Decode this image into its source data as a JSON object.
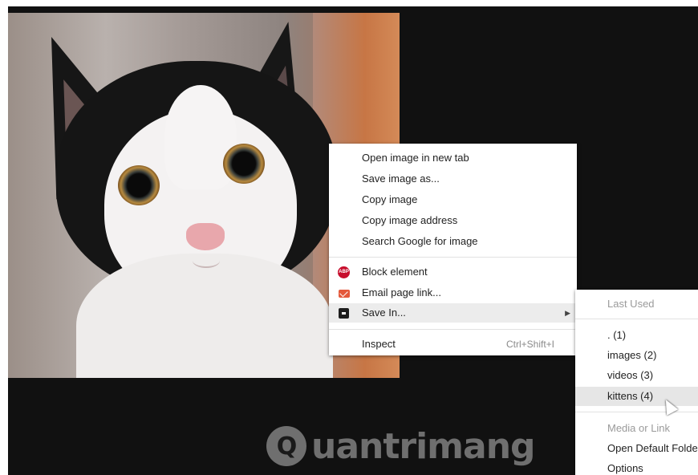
{
  "context_menu": {
    "items": [
      {
        "label": "Open image in new tab"
      },
      {
        "label": "Save image as..."
      },
      {
        "label": "Copy image"
      },
      {
        "label": "Copy image address"
      },
      {
        "label": "Search Google for image"
      },
      {
        "label": "Block element",
        "icon": "adblock-plus-icon"
      },
      {
        "label": "Email page link...",
        "icon": "email-icon"
      },
      {
        "label": "Save In...",
        "icon": "save-in-icon",
        "has_submenu": true
      },
      {
        "label": "Inspect",
        "shortcut": "Ctrl+Shift+I"
      }
    ],
    "abp_icon_text": "ABP"
  },
  "submenu": {
    "last_used_header": "Last Used",
    "folders": [
      {
        "label": ". (1)"
      },
      {
        "label": "images (2)"
      },
      {
        "label": "videos (3)"
      },
      {
        "label": "kittens (4)"
      }
    ],
    "media_header": "Media or Link",
    "actions": [
      {
        "label": "Open Default Folder"
      },
      {
        "label": "Options"
      }
    ]
  },
  "watermark": {
    "text": "uantrimang",
    "badge": "Q"
  },
  "colors": {
    "background": "#111111",
    "menu_highlight": "#ececec",
    "abp_red": "#c70d2c",
    "mail_orange": "#e4593c"
  }
}
